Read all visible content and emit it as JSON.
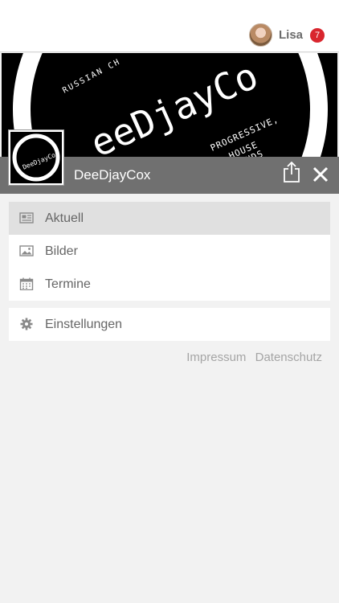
{
  "user": {
    "name": "Lisa",
    "notifications": "7"
  },
  "banner": {
    "brand_text": "eeDjayCo",
    "ring_text_left": "RUSSIAN CH",
    "ring_text_right_1": "PROGRESSIVE,",
    "ring_text_right_2": "HOUSE",
    "ring_text_right_3": "SOUNDS"
  },
  "logo": {
    "text": "DeeDjayCox"
  },
  "page": {
    "title": "DeeDjayCox"
  },
  "menu": {
    "items": [
      {
        "label": "Aktuell",
        "icon": "newspaper-icon",
        "active": true
      },
      {
        "label": "Bilder",
        "icon": "image-icon",
        "active": false
      },
      {
        "label": "Termine",
        "icon": "calendar-icon",
        "active": false
      }
    ],
    "settings": {
      "label": "Einstellungen",
      "icon": "gear-icon"
    }
  },
  "footer": {
    "impressum": "Impressum",
    "datenschutz": "Datenschutz"
  },
  "colors": {
    "badge": "#d9262e",
    "titlebar": "#707070",
    "active_row": "#e0e0e0"
  }
}
